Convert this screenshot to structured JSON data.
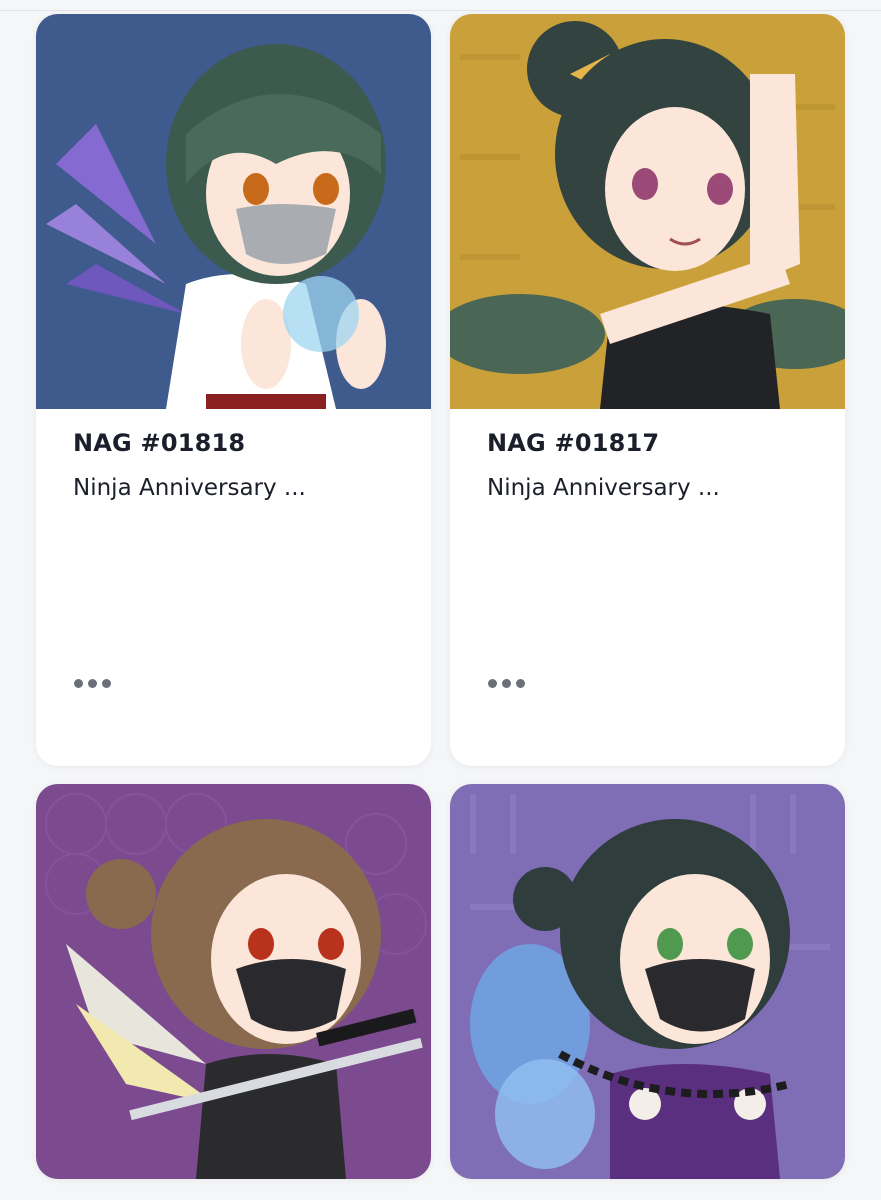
{
  "nfts": [
    {
      "name": "NAG #01818",
      "collection": "Ninja Anniversary ...",
      "bg": "#3f5a8d",
      "hair": "#3d5a4f",
      "eyes": "#c76a1a",
      "mask": "#a9acb0",
      "wings": "#8d6bd8",
      "outfit": "#ffffff"
    },
    {
      "name": "NAG #01817",
      "collection": "Ninja Anniversary ...",
      "bg": "#c9a03a",
      "hair": "#33433f",
      "eyes": "#9b4a78",
      "mask": "none",
      "wings": "#4a6655",
      "outfit": "#222326"
    },
    {
      "name": "",
      "collection": "",
      "bg": "#7b4a8f",
      "hair": "#8a6a4f",
      "eyes": "#b8321c",
      "mask": "#2a2a2e",
      "wings": "#e8e6dc",
      "outfit": "#2b2b2e"
    },
    {
      "name": "",
      "collection": "",
      "bg": "#7f6db6",
      "hair": "#2f3d3d",
      "eyes": "#4f9a4e",
      "mask": "#2a2a2e",
      "wings": "#6ea6e4",
      "outfit": "#5a2f80"
    }
  ],
  "more_icon": "ellipsis-icon"
}
